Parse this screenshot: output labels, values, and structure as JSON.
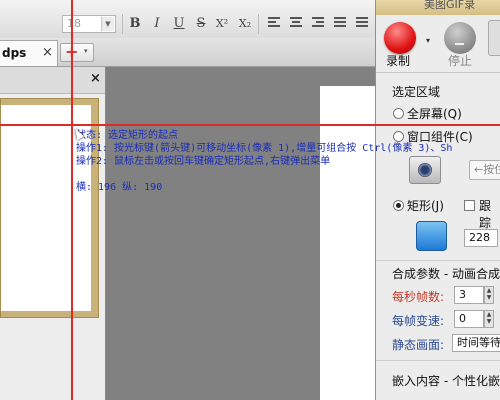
{
  "toolbar": {
    "font_size": "18",
    "bold": "B",
    "italic": "I",
    "underline": "U",
    "strike": "S",
    "superscript": "X²",
    "subscript": "X₂"
  },
  "tabs": {
    "doc_tab_label": "dps",
    "close_glyph": "×",
    "new_tab_plus": "+",
    "caret": "▾"
  },
  "left_pane": {
    "close_glyph": "×"
  },
  "overlay": {
    "status": "状态: 选定矩形的起点",
    "op1": "操作1: 按光标键(箭头键)可移动坐标(像素 1),增量可组合按 Ctrl(像素 3)、Sh",
    "op2": "操作2: 鼠标左击或按回车键确定矩形起点,右键弹出菜单",
    "coords": "横: 196 纵: 190"
  },
  "panel": {
    "title": "美图GIF录",
    "record_label": "录制",
    "record_caret": "▾",
    "stop_label": "停止",
    "region_section": "选定区域",
    "full_screen": "全屏幕(Q)",
    "window_component": "窗口组件(C)",
    "grab_button": "←按住",
    "rectangle": "矩形(J)",
    "follow": "跟踪",
    "rect_value": "228",
    "synthesis_params": "合成参数 - 动画合成",
    "fps_label": "每秒帧数:",
    "fps_value": "3",
    "frame_speed_label": "每帧变速:",
    "frame_speed_value": "0",
    "static_label": "静态画面:",
    "static_value": "时间等待",
    "embed_label": "嵌入内容 - 个性化嵌",
    "spin_up": "▲",
    "spin_down": "▼"
  },
  "colors": {
    "crosshair": "#e02a2a",
    "info_text": "#1a2eb8",
    "record": "#e01212"
  }
}
